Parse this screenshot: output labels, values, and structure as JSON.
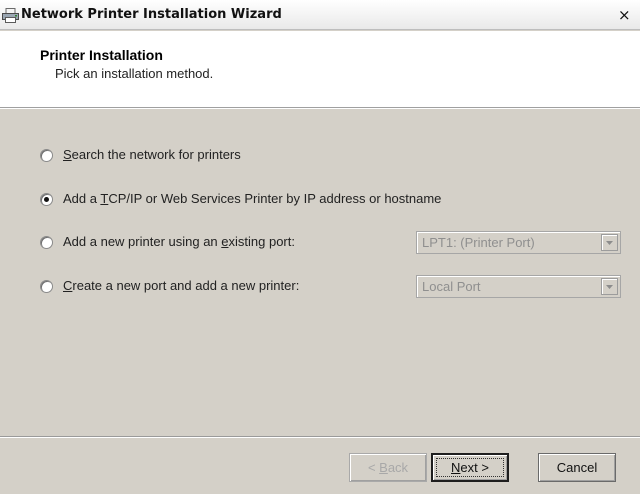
{
  "window": {
    "title": "Network Printer Installation Wizard",
    "close_glyph": "×",
    "icon": "printer-icon"
  },
  "header": {
    "title": "Printer Installation",
    "subtitle": "Pick an installation method."
  },
  "options": [
    {
      "pre": "",
      "key": "S",
      "post": "earch the network for printers",
      "selected": false
    },
    {
      "pre": "Add a ",
      "key": "T",
      "post": "CP/IP or Web Services Printer by IP address or hostname",
      "selected": true
    },
    {
      "pre": "Add a new printer using an ",
      "key": "e",
      "post": "xisting port:",
      "selected": false,
      "dropdown": {
        "value": "LPT1: (Printer Port)",
        "enabled": false
      }
    },
    {
      "pre": "",
      "key": "C",
      "post": "reate a new port and add a new printer:",
      "selected": false,
      "dropdown": {
        "value": "Local Port",
        "enabled": false
      }
    }
  ],
  "footer": {
    "back": {
      "pre": "< ",
      "key": "B",
      "post": "ack",
      "enabled": false
    },
    "next": {
      "pre": "",
      "key": "N",
      "post": "ext >",
      "enabled": true,
      "default": true
    },
    "cancel": {
      "label": "Cancel",
      "enabled": true
    }
  },
  "colors": {
    "dialog_bg": "#d4d0c8",
    "header_bg": "#ffffff",
    "disabled_text": "#a8a8a8"
  }
}
